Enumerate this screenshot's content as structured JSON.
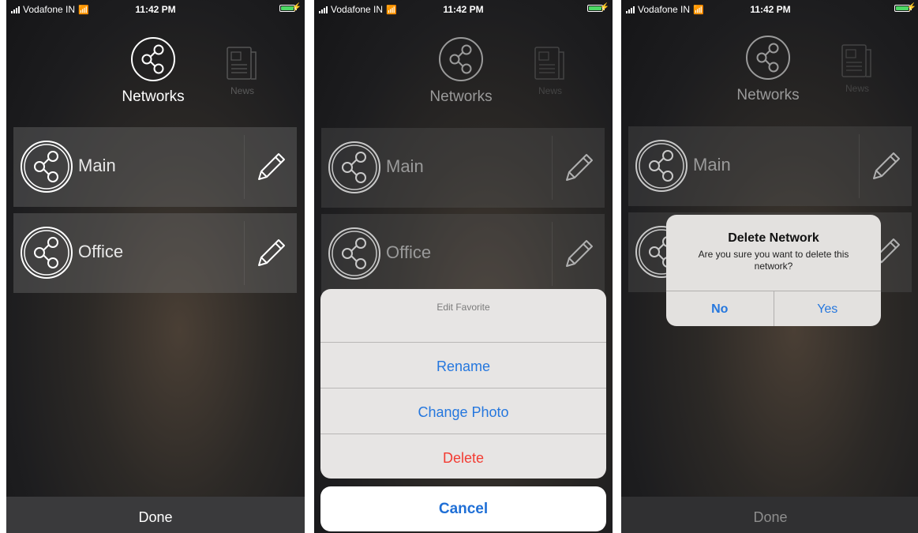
{
  "status": {
    "carrier": "Vodafone IN",
    "time": "11:42 PM",
    "battery_color": "#4cd964"
  },
  "tabs": {
    "networks": "Networks",
    "news": "News"
  },
  "networks": [
    {
      "name": "Main"
    },
    {
      "name": "Office"
    }
  ],
  "done_label": "Done",
  "action_sheet": {
    "title": "Edit Favorite",
    "rename": "Rename",
    "change_photo": "Change Photo",
    "delete": "Delete",
    "cancel": "Cancel"
  },
  "alert": {
    "title": "Delete Network",
    "message": "Are you sure you want to delete this network?",
    "no": "No",
    "yes": "Yes"
  },
  "colors": {
    "accent_blue": "#2577de",
    "destructive_red": "#f33b32"
  }
}
